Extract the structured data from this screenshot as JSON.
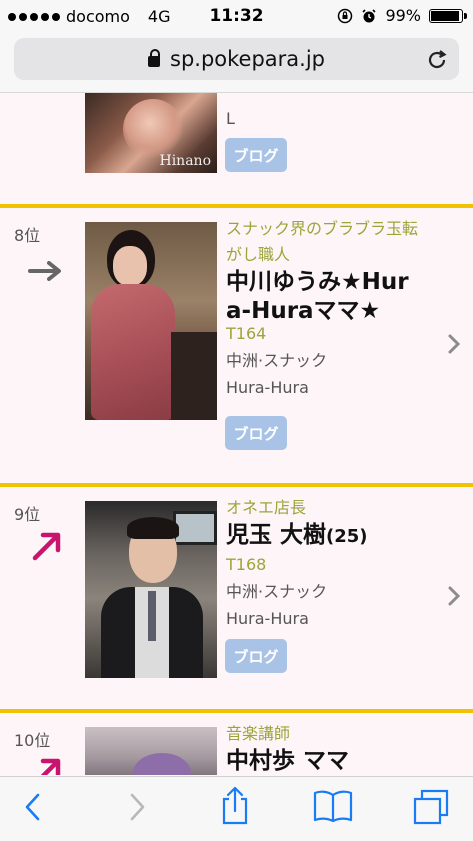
{
  "status_bar": {
    "carrier": "docomo",
    "network": "4G",
    "time": "11:32",
    "battery": "99%",
    "battery_level": 0.99
  },
  "browser": {
    "url": "sp.pokepara.jp"
  },
  "previous_item": {
    "partial_text": "L",
    "watermark": "Hinano",
    "blog_label": "ブログ"
  },
  "items": [
    {
      "rank": "8位",
      "trend": "same",
      "catchphrase": [
        "スナック界のブラブラ玉転",
        "がし職人"
      ],
      "name": [
        "中川ゆうみ★Hur",
        "a-Huraママ★"
      ],
      "age": "",
      "height": "T164",
      "area": "中洲·スナック",
      "shop": "Hura-Hura",
      "blog_label": "ブログ"
    },
    {
      "rank": "9位",
      "trend": "up",
      "catchphrase": [
        "オネエ店長"
      ],
      "name": [
        "児玉 大樹"
      ],
      "age": "(25)",
      "height": "T168",
      "area": "中洲·スナック",
      "shop": "Hura-Hura",
      "blog_label": "ブログ"
    },
    {
      "rank": "10位",
      "trend": "up",
      "catchphrase": [
        "音楽講師"
      ],
      "name": [
        "中村歩 ママ"
      ]
    }
  ],
  "colors": {
    "separator": "#f2c200",
    "accent_green": "#9aa63a",
    "blog_button": "#a9c3e6",
    "trend_up": "#c8146e",
    "background": "#fef5f8"
  }
}
